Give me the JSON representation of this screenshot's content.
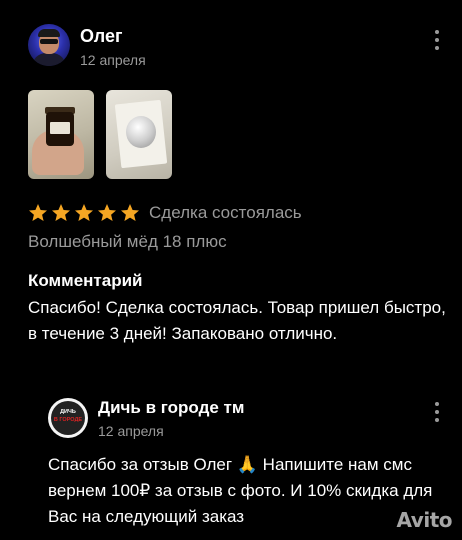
{
  "review": {
    "author_name": "Олег",
    "date": "12 апреля",
    "rating": 5,
    "status": "Сделка состоялась",
    "product": "Волшебный мёд 18 плюс",
    "comment_heading": "Комментарий",
    "comment_text": "Спасибо! Сделка состоялась. Товар пришел быстро, в течение 3 дней! Запаковано отлично."
  },
  "reply": {
    "seller_name": "Дичь в городе тм",
    "seller_logo_line1": "ДИЧЬ",
    "seller_logo_line2": "В ГОРОДЕ",
    "date": "12 апреля",
    "text": "Спасибо за отзыв Олег 🙏 Напишите нам смс вернем 100₽ за отзыв с фото. И 10% скидка для Вас на следующий заказ"
  },
  "watermark": "Avito",
  "colors": {
    "background": "#000000",
    "star": "#f5a623",
    "muted_text": "#9a9a9a"
  }
}
